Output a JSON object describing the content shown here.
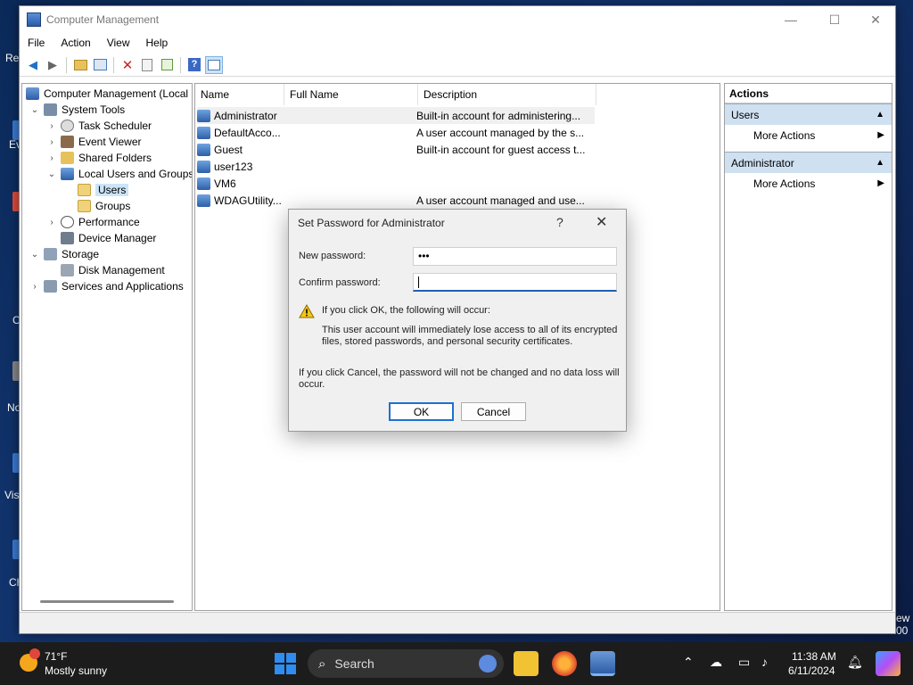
{
  "window": {
    "title": "Computer Management",
    "controls": {
      "minimize": "—",
      "maximize": "☐",
      "close": "✕"
    }
  },
  "menu": [
    "File",
    "Action",
    "View",
    "Help"
  ],
  "tree": {
    "root": "Computer Management (Local",
    "system_tools": "System Tools",
    "task_scheduler": "Task Scheduler",
    "event_viewer": "Event Viewer",
    "shared_folders": "Shared Folders",
    "local_users_groups": "Local Users and Groups",
    "users": "Users",
    "groups": "Groups",
    "performance": "Performance",
    "device_manager": "Device Manager",
    "storage": "Storage",
    "disk_management": "Disk Management",
    "services_apps": "Services and Applications"
  },
  "list": {
    "columns": {
      "name": "Name",
      "full_name": "Full Name",
      "description": "Description"
    },
    "rows": [
      {
        "name": "Administrator",
        "full_name": "",
        "description": "Built-in account for administering..."
      },
      {
        "name": "DefaultAcco...",
        "full_name": "",
        "description": "A user account managed by the s..."
      },
      {
        "name": "Guest",
        "full_name": "",
        "description": "Built-in account for guest access t..."
      },
      {
        "name": "user123",
        "full_name": "",
        "description": ""
      },
      {
        "name": "VM6",
        "full_name": "",
        "description": ""
      },
      {
        "name": "WDAGUtility...",
        "full_name": "",
        "description": "A user account managed and use..."
      }
    ]
  },
  "actions": {
    "title": "Actions",
    "section1": "Users",
    "section1_item": "More Actions",
    "section2": "Administrator",
    "section2_item": "More Actions"
  },
  "dialog": {
    "title": "Set Password for Administrator",
    "help": "?",
    "close": "✕",
    "new_password_label": "New password:",
    "new_password_value": "•••",
    "confirm_password_label": "Confirm password:",
    "warning_heading": "If you click OK, the following will occur:",
    "warning_line1": "This user account will immediately lose access to all of its encrypted",
    "warning_line2": "files, stored passwords, and personal security certificates.",
    "cancel_line1": "If you click Cancel, the password will not be changed and no data loss will",
    "cancel_line2": "occur.",
    "ok_label": "OK",
    "cancel_label": "Cancel"
  },
  "desktop_fragments": [
    "Re",
    "Ev",
    "C",
    "No",
    "Vis",
    "Ch",
    "ew",
    "00"
  ],
  "taskbar": {
    "temperature": "71°F",
    "weather": "Mostly sunny",
    "search_label": "Search",
    "time": "11:38 AM",
    "date": "6/11/2024"
  },
  "colors": {
    "accent": "#1f6fd1",
    "selection": "#cce4f7",
    "action_section": "#cfe0f1"
  }
}
